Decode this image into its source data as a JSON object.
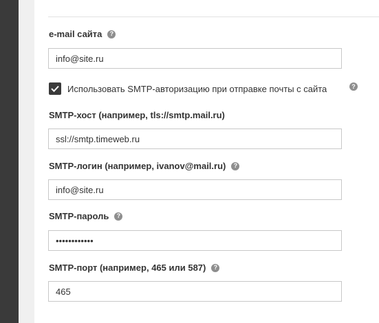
{
  "form": {
    "email": {
      "label": "e-mail сайта",
      "value": "info@site.ru"
    },
    "smtp_auth": {
      "label": "Использовать SMTP-авторизацию при отправке почты с сайта",
      "checked": true
    },
    "smtp_host": {
      "label": "SMTP-хост (например, tls://smtp.mail.ru)",
      "value": "ssl://smtp.timeweb.ru"
    },
    "smtp_login": {
      "label": "SMTP-логин (например, ivanov@mail.ru)",
      "value": "info@site.ru"
    },
    "smtp_password": {
      "label": "SMTP-пароль",
      "value": "••••••••••••"
    },
    "smtp_port": {
      "label": "SMTP-порт (например, 465 или 587)",
      "value": "465"
    }
  },
  "icons": {
    "help": "question-circle-icon",
    "check": "checkmark-icon"
  },
  "colors": {
    "sidebar": "#3a3a3a",
    "background": "#f0f0f0",
    "panel": "#ffffff",
    "border": "#c8c8c8",
    "help_icon": "#8e8e8e"
  }
}
